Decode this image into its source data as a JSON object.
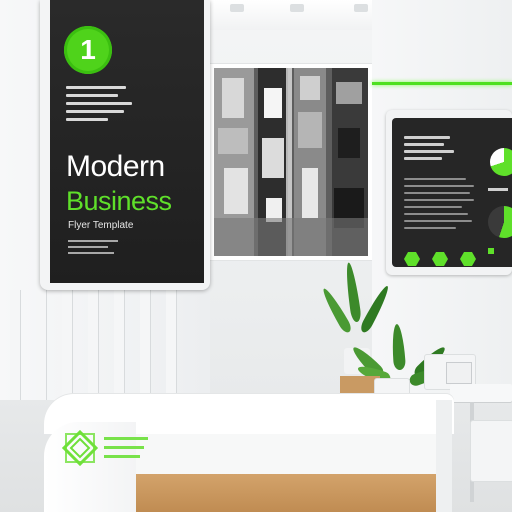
{
  "flyer": {
    "badge_number": "1",
    "title_line1": "Modern",
    "title_line2": "Business",
    "subtitle": "Flyer Template"
  },
  "desk_logo": {
    "icon": "diamond-logo-icon"
  },
  "colors": {
    "accent_green": "#5fe02a",
    "flyer_background": "#252525",
    "desk_wood": "#c99a63"
  },
  "right_screen": {
    "hexagon_count": 3,
    "chart_type": "pie"
  }
}
